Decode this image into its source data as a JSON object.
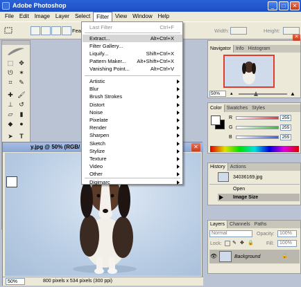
{
  "app": {
    "title": "Adobe Photoshop"
  },
  "menubar": {
    "items": [
      "File",
      "Edit",
      "Image",
      "Layer",
      "Select",
      "Filter",
      "View",
      "Window",
      "Help"
    ]
  },
  "options": {
    "feather_label": "Feath",
    "width_label": "Width:",
    "height_label": "Height:"
  },
  "filter_menu": {
    "last_filter": {
      "label": "Last Filter",
      "shortcut": "Ctrl+F"
    },
    "top_items": [
      {
        "label": "Extract...",
        "shortcut": "Alt+Ctrl+X"
      },
      {
        "label": "Filter Gallery...",
        "shortcut": ""
      },
      {
        "label": "Liquify...",
        "shortcut": "Shift+Ctrl+X"
      },
      {
        "label": "Pattern Maker...",
        "shortcut": "Alt+Shift+Ctrl+X"
      },
      {
        "label": "Vanishing Point...",
        "shortcut": "Alt+Ctrl+V"
      }
    ],
    "submenus": [
      "Artistic",
      "Blur",
      "Brush Strokes",
      "Distort",
      "Noise",
      "Pixelate",
      "Render",
      "Sharpen",
      "Sketch",
      "Stylize",
      "Texture",
      "Video",
      "Other"
    ],
    "bottom_item": "Digimarc"
  },
  "document": {
    "title": "y.jpg @ 50% (RGB/",
    "zoom": "50%",
    "status": "800 pixels x 534 pixels (300 ppi)"
  },
  "navigator_panel": {
    "tabs": [
      "Navigator",
      "Info",
      "Histogram"
    ],
    "zoom": "50%"
  },
  "color_panel": {
    "tabs": [
      "Color",
      "Swatches",
      "Styles"
    ],
    "channels": [
      {
        "label": "R",
        "value": "255",
        "color": "#e53838"
      },
      {
        "label": "G",
        "value": "255",
        "color": "#2fbf3a"
      },
      {
        "label": "B",
        "value": "255",
        "color": "#3a5fe0"
      }
    ]
  },
  "history_panel": {
    "tabs": [
      "History",
      "Actions"
    ],
    "snapshot": "34036169.jpg",
    "states": [
      "Open",
      "Image Size"
    ]
  },
  "layers_panel": {
    "tabs": [
      "Layers",
      "Channels",
      "Paths"
    ],
    "blend_mode": "Normal",
    "opacity_label": "Opacity:",
    "opacity": "100%",
    "lock_label": "Lock:",
    "fill_label": "Fill:",
    "fill": "100%",
    "layer_name": "Background"
  }
}
